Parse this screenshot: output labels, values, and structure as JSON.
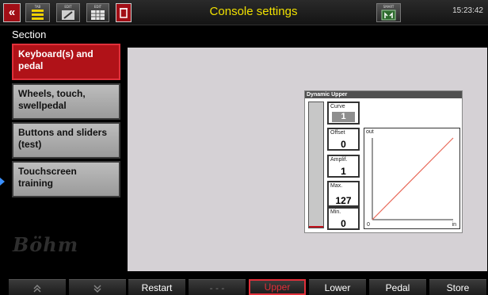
{
  "topbar": {
    "back_icon": "«",
    "icon1_label": "TAB",
    "icon2_label": "EDIT",
    "icon3_label": "EDIT",
    "icon5_label": "SMART",
    "title": "Console settings",
    "clock": "15:23:42"
  },
  "section": {
    "label": "Section",
    "items": [
      {
        "label": "Keyboard(s) and pedal",
        "active": true
      },
      {
        "label": "Wheels, touch, swellpedal",
        "active": false
      },
      {
        "label": "Buttons and sliders (test)",
        "active": false
      },
      {
        "label": "Touchscreen training",
        "active": false
      }
    ]
  },
  "logo": "Böhm",
  "dynamic": {
    "title": "Dynamic Upper",
    "curve_label": "Curve",
    "curve_value": "1",
    "offset_label": "Offset",
    "offset_value": "0",
    "ampl_label": "Amplif.",
    "ampl_value": "1",
    "max_label": "Max.",
    "max_value": "127",
    "min_label": "Min.",
    "min_value": "0",
    "graph_out": "out",
    "graph_in": "in",
    "graph_zero": "0"
  },
  "bottom": {
    "up": "≈",
    "down": "¥",
    "restart": "Restart",
    "dashes": "- - -",
    "upper": "Upper",
    "lower": "Lower",
    "pedal": "Pedal",
    "store": "Store"
  },
  "colors": {
    "accent_red": "#b01218",
    "title_yellow": "#f0e000",
    "curve_line": "#e86a5a"
  }
}
